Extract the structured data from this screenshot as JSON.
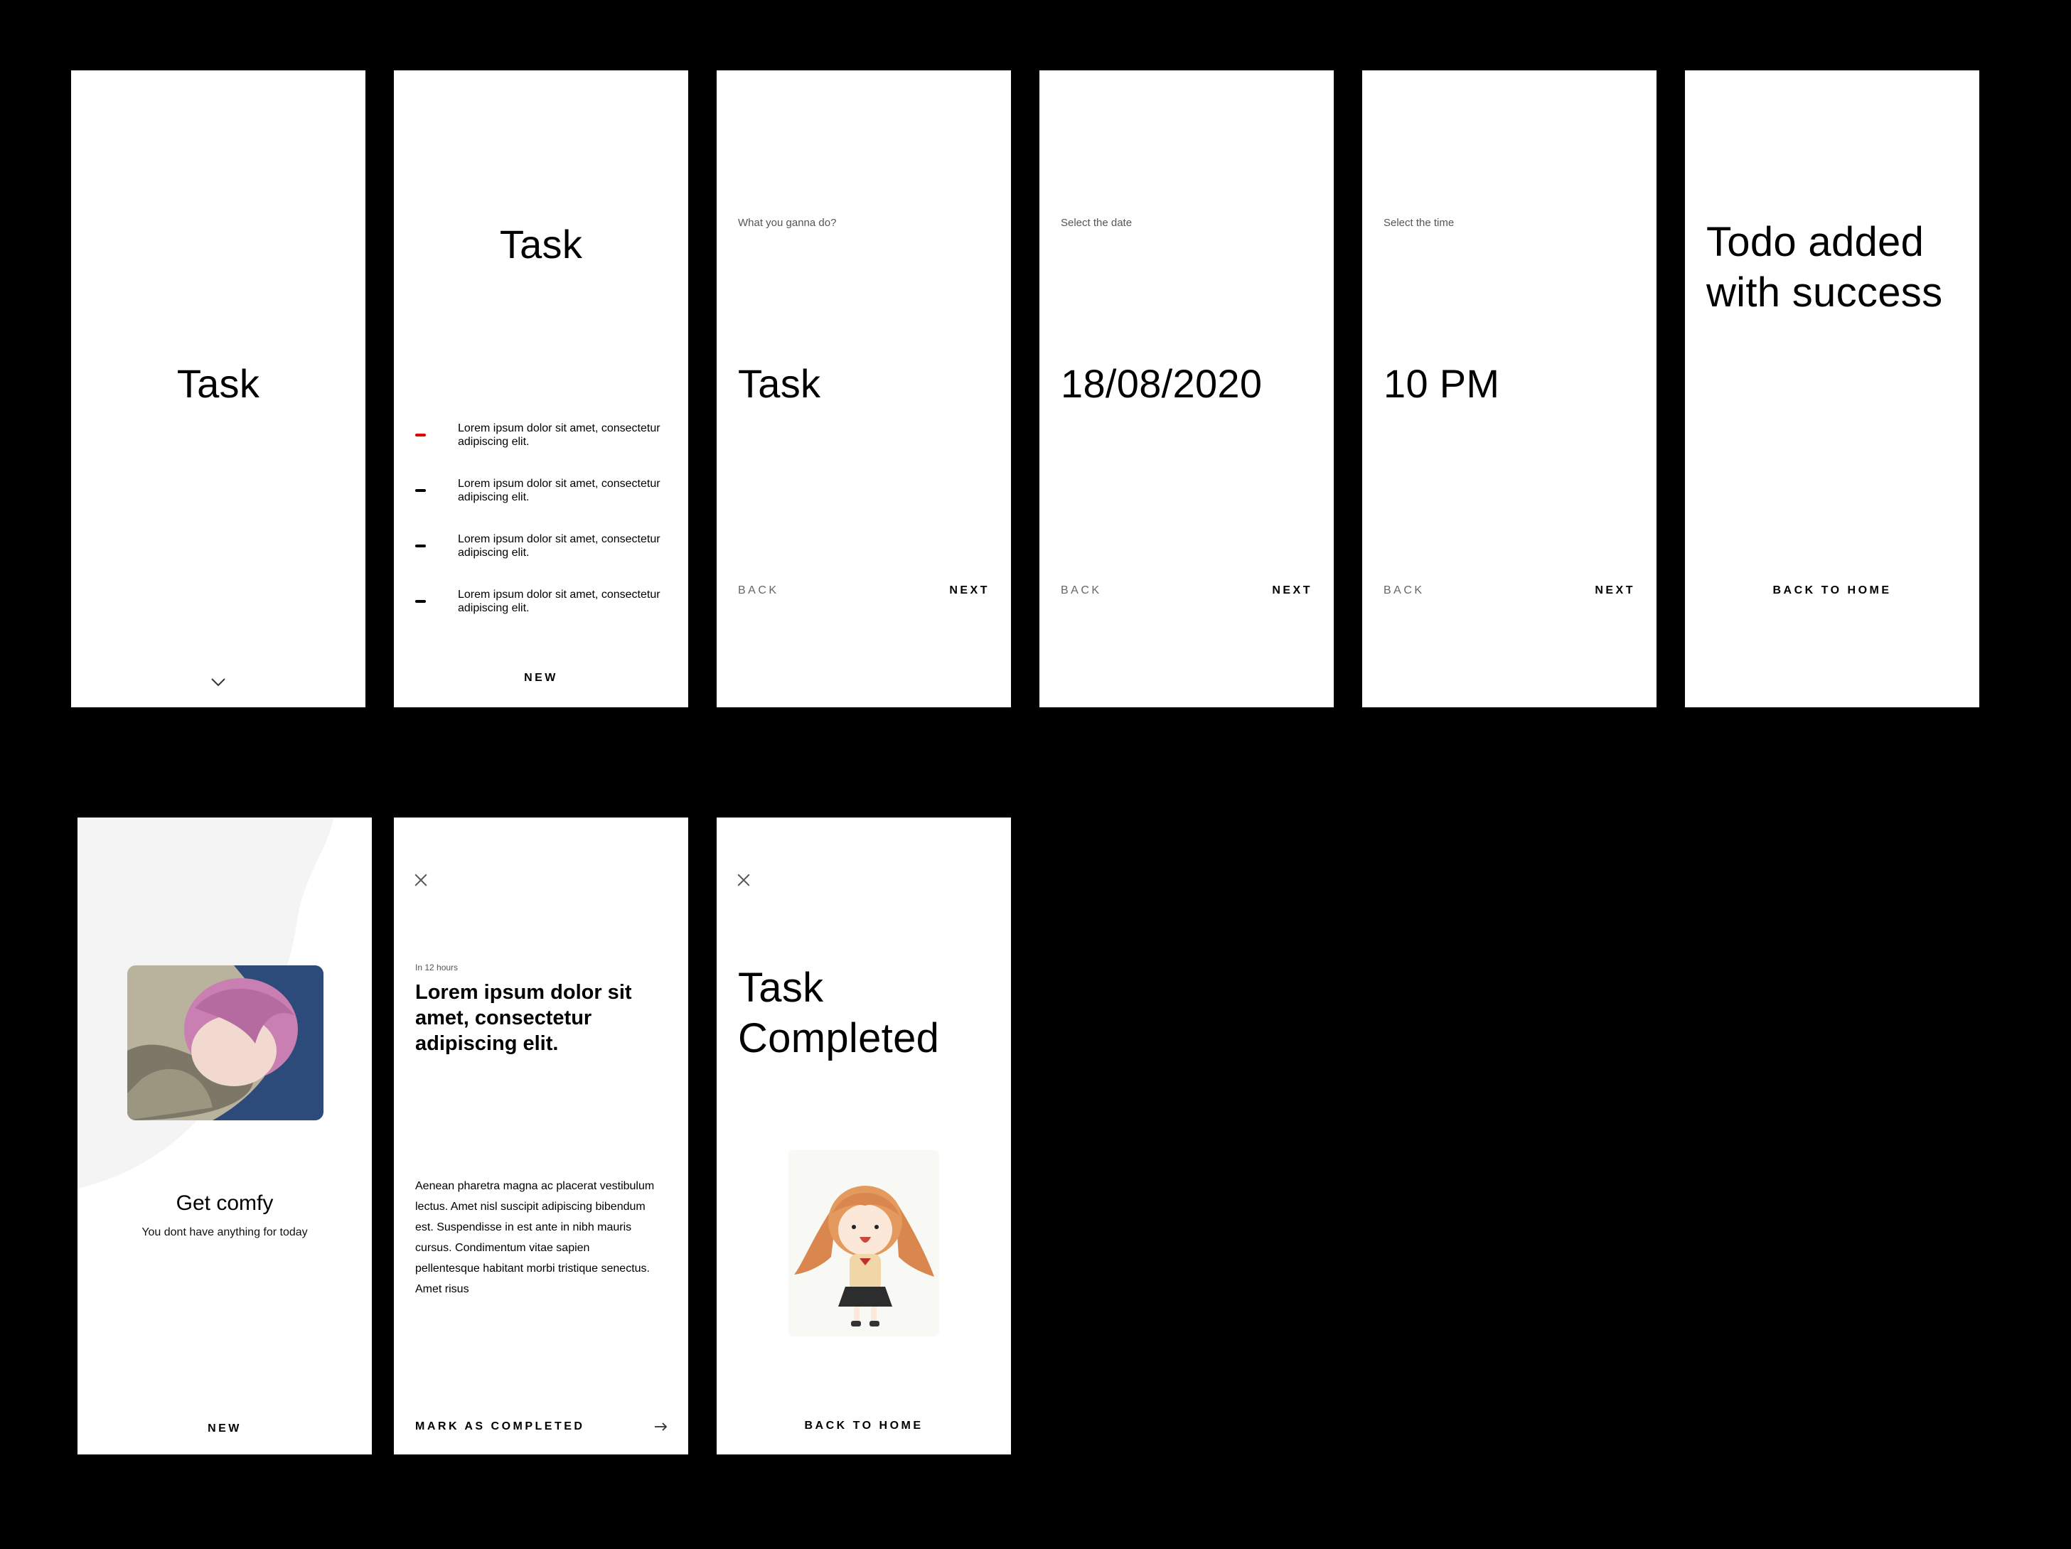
{
  "screens": {
    "s1": {
      "title": "Task"
    },
    "s2": {
      "title": "Task",
      "items": [
        "Lorem ipsum dolor sit amet, consectetur adipiscing elit.",
        "Lorem ipsum dolor sit amet, consectetur adipiscing elit.",
        "Lorem ipsum dolor sit amet, consectetur adipiscing elit.",
        "Lorem ipsum dolor sit amet, consectetur adipiscing elit."
      ],
      "new_label": "NEW"
    },
    "s3": {
      "prompt": "What you ganna do?",
      "value": "Task",
      "back": "BACK",
      "next": "NEXT"
    },
    "s4": {
      "prompt": "Select the date",
      "value": "18/08/2020",
      "back": "BACK",
      "next": "NEXT"
    },
    "s5": {
      "prompt": "Select the time",
      "value": "10 PM",
      "back": "BACK",
      "next": "NEXT"
    },
    "s6": {
      "title": "Todo added with success",
      "back_home": "BACK TO HOME"
    },
    "s7": {
      "title": "Get comfy",
      "subtitle": "You dont have anything for today",
      "new_label": "NEW"
    },
    "s8": {
      "meta": "In 12 hours",
      "title": "Lorem ipsum dolor sit amet, consectetur adipiscing elit.",
      "body": "Aenean pharetra magna ac placerat vestibulum lectus. Amet nisl suscipit adipiscing bibendum est. Suspendisse in est ante in nibh mauris cursus. Condimentum vitae sapien pellentesque habitant morbi tristique senectus. Amet risus",
      "action": "MARK AS COMPLETED"
    },
    "s9": {
      "title": "Task Completed",
      "back_home": "BACK TO HOME"
    }
  },
  "colors": {
    "background": "#000000",
    "screen": "#ffffff",
    "accent_red": "#e10000",
    "blob": "#f4f4f4"
  },
  "icons": {
    "chevron": "chevron-down-icon",
    "close": "close-icon",
    "arrow": "arrow-right-icon"
  }
}
